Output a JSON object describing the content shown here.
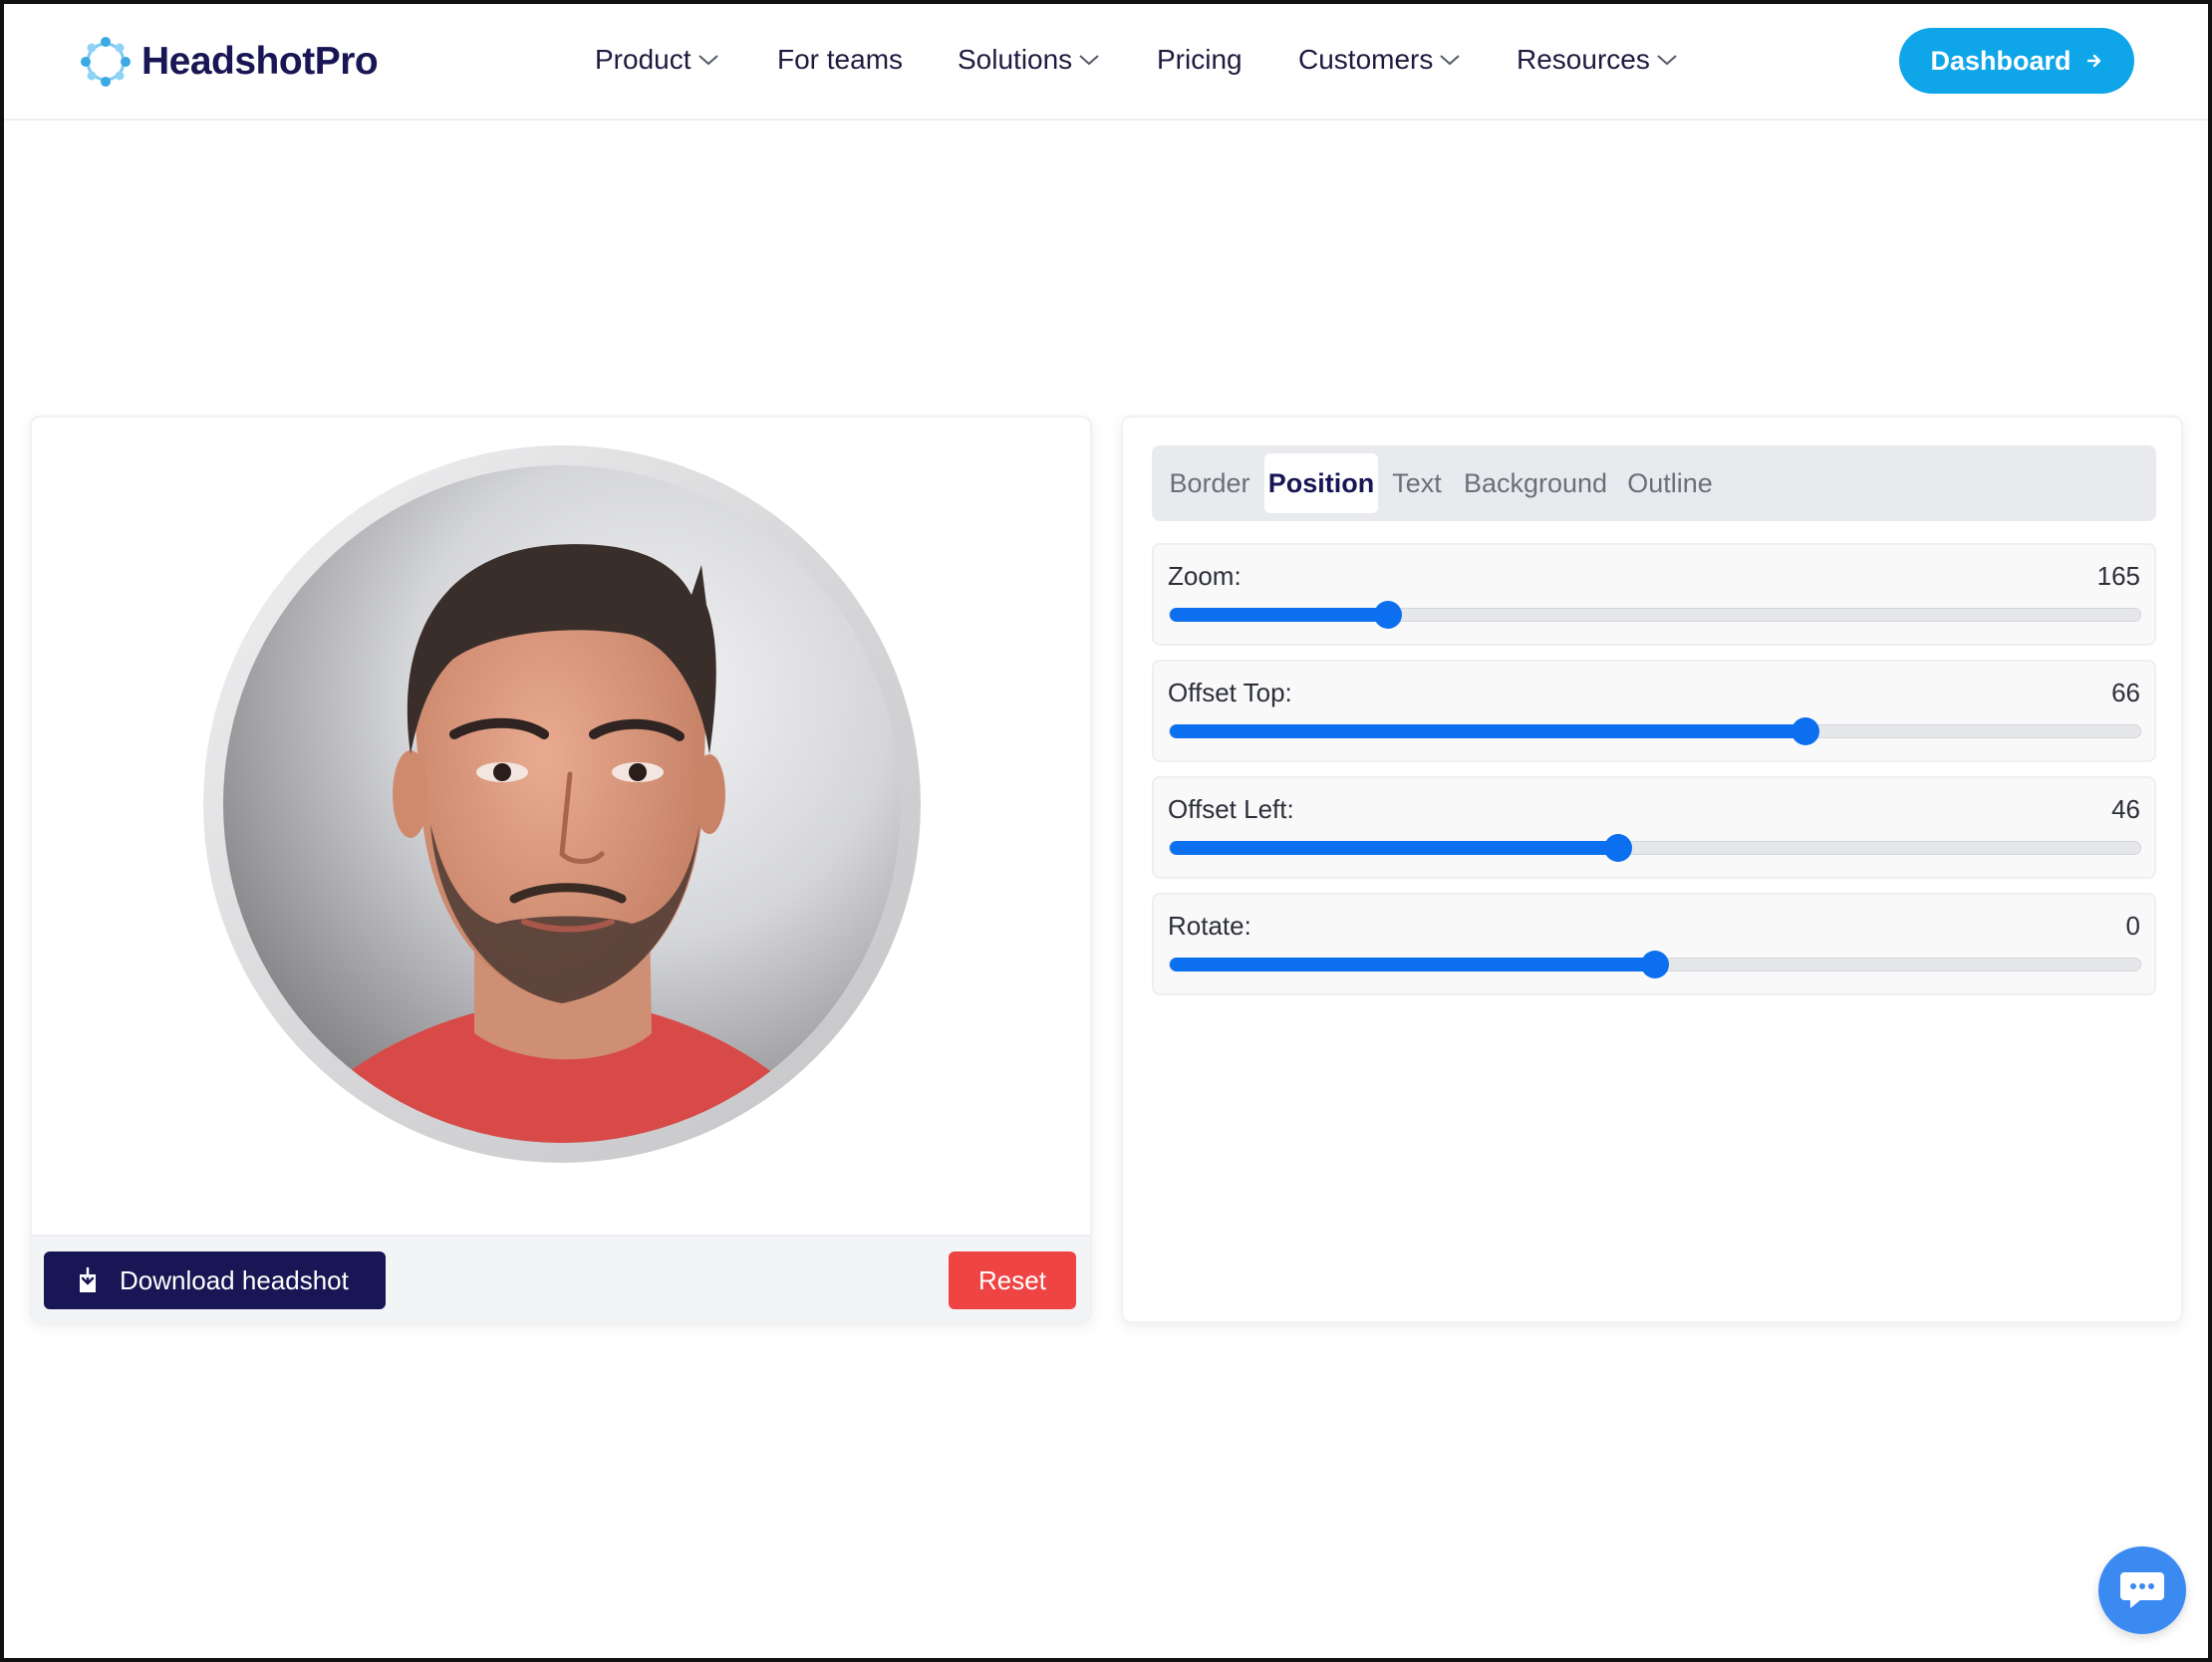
{
  "brand": {
    "name": "HeadshotPro",
    "accent": "#0ea5e9",
    "navy": "#181654"
  },
  "nav": {
    "items": [
      {
        "label": "Product",
        "dropdown": true
      },
      {
        "label": "For teams",
        "dropdown": false
      },
      {
        "label": "Solutions",
        "dropdown": true
      },
      {
        "label": "Pricing",
        "dropdown": false
      },
      {
        "label": "Customers",
        "dropdown": true
      },
      {
        "label": "Resources",
        "dropdown": true
      }
    ],
    "dashboard_label": "Dashboard",
    "dashboard_icon": "arrow-right-icon"
  },
  "editor": {
    "download_label": "Download headshot",
    "download_icon": "download-icon",
    "reset_label": "Reset",
    "reset_color": "#ef4444"
  },
  "controls": {
    "tabs": [
      {
        "label": "Border",
        "active": false
      },
      {
        "label": "Position",
        "active": true
      },
      {
        "label": "Text",
        "active": false
      },
      {
        "label": "Background",
        "active": false
      },
      {
        "label": "Outline",
        "active": false
      }
    ],
    "sliders": [
      {
        "label": "Zoom:",
        "value": "165",
        "fill_fraction": 0.225
      },
      {
        "label": "Offset Top:",
        "value": "66",
        "fill_fraction": 0.655
      },
      {
        "label": "Offset Left:",
        "value": "46",
        "fill_fraction": 0.462
      },
      {
        "label": "Rotate:",
        "value": "0",
        "fill_fraction": 0.5
      }
    ],
    "slider_color": "#0b6ff0"
  },
  "chat": {
    "icon": "chat-bubble-icon"
  }
}
